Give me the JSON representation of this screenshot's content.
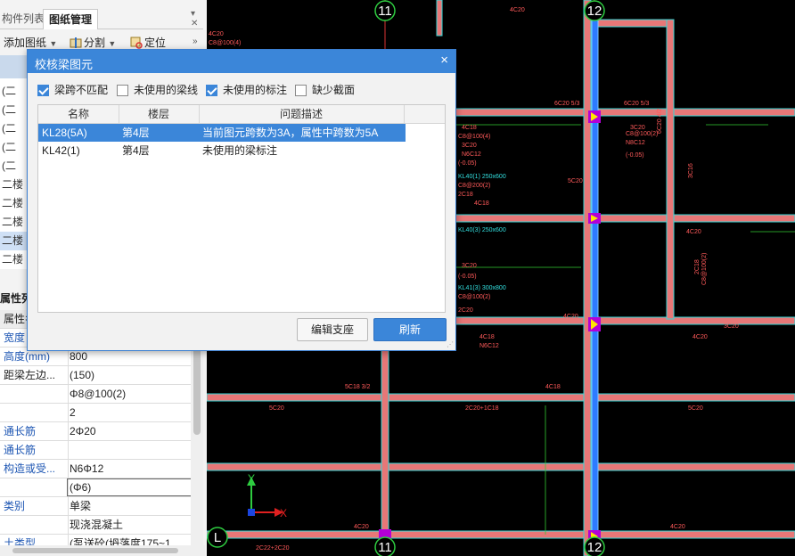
{
  "left_panel": {
    "tab_component_list": "构件列表",
    "tab_drawing_manage": "图纸管理",
    "toolbar": {
      "add_drawing": "添加图纸",
      "split": "分割",
      "locate": "定位"
    },
    "tree_items": [
      "(二",
      "(二",
      "(二",
      "(二",
      "(二",
      "二楼",
      "二楼",
      "二楼",
      "二楼",
      "二楼",
      "二楼"
    ],
    "properties_title": "属性列表",
    "properties": [
      {
        "name": "属性名",
        "value": "",
        "style": "plain"
      },
      {
        "name": "宽度",
        "value": "",
        "style": "link"
      },
      {
        "name": "高度(mm)",
        "value": "800",
        "style": "link"
      },
      {
        "name": "距梁左边...",
        "value": "(150)",
        "style": "plain"
      },
      {
        "name": "",
        "value": "Φ8@100(2)",
        "style": "plain"
      },
      {
        "name": "",
        "value": "2",
        "style": "plain"
      },
      {
        "name": "通长筋",
        "value": "2Φ20",
        "style": "link"
      },
      {
        "name": "通长筋",
        "value": "",
        "style": "link"
      },
      {
        "name": "构造或受...",
        "value": "N6Φ12",
        "style": "link"
      },
      {
        "name": "",
        "value": "(Φ6)",
        "style": "edit"
      },
      {
        "name": "类别",
        "value": "单梁",
        "style": "link"
      },
      {
        "name": "",
        "value": "现浇混凝土",
        "style": "plain"
      },
      {
        "name": "土类型",
        "value": "(泵送砼(坍落度175~1",
        "style": "link"
      }
    ]
  },
  "dialog": {
    "title": "校核梁图元",
    "close_icon": "×",
    "filters": [
      {
        "label": "梁跨不匹配",
        "checked": true
      },
      {
        "label": "未使用的梁线",
        "checked": false
      },
      {
        "label": "未使用的标注",
        "checked": true
      },
      {
        "label": "缺少截面",
        "checked": false
      }
    ],
    "columns": [
      "名称",
      "楼层",
      "问题描述"
    ],
    "rows": [
      {
        "name": "KL28(5A)",
        "floor": "第4层",
        "desc": "当前图元跨数为3A，属性中跨数为5A",
        "selected": true
      },
      {
        "name": "KL42(1)",
        "floor": "第4层",
        "desc": "未使用的梁标注",
        "selected": false
      }
    ],
    "edit_support_button": "编辑支座",
    "refresh_button": "刷新"
  },
  "cad": {
    "axis_labels": [
      "11",
      "12",
      "L",
      "11",
      "12"
    ],
    "ucs_x": "X",
    "ucs_y": "Y",
    "annotations": [
      "4C20",
      "C8@100(4)",
      "4C20",
      "4C18",
      "C8@100(4)",
      "3C20",
      "N6C12",
      "(-0.05)",
      "KL40(1) 250x600",
      "C8@200(2)",
      "2C18",
      "4C18",
      "KL40(3) 250x600",
      "3C20",
      "(-0.05)",
      "KL41(3) 300x800",
      "C8@100(2)",
      "2C20",
      "4C18",
      "N6C12",
      "5C18 3/2",
      "5C20",
      "2C20+1C18",
      "4C20",
      "4C18",
      "5C20",
      "2C22+2C20",
      "4C20",
      "6C20 5/3",
      "6C20 5/3",
      "3C20",
      "C8@100(2)",
      "N8C12",
      "(-0.05)",
      "6C20 4/2",
      "3C16",
      "4C20",
      "5C20",
      "2C18",
      "C8@100(2)",
      "4C20",
      "3C20",
      "4C20"
    ]
  },
  "colors": {
    "beam_fill": "#e77777",
    "beam_edge": "#35d7d7",
    "selected_beam": "#2e7bff",
    "dialog_accent": "#3b86d9",
    "cad_background": "#000000"
  }
}
